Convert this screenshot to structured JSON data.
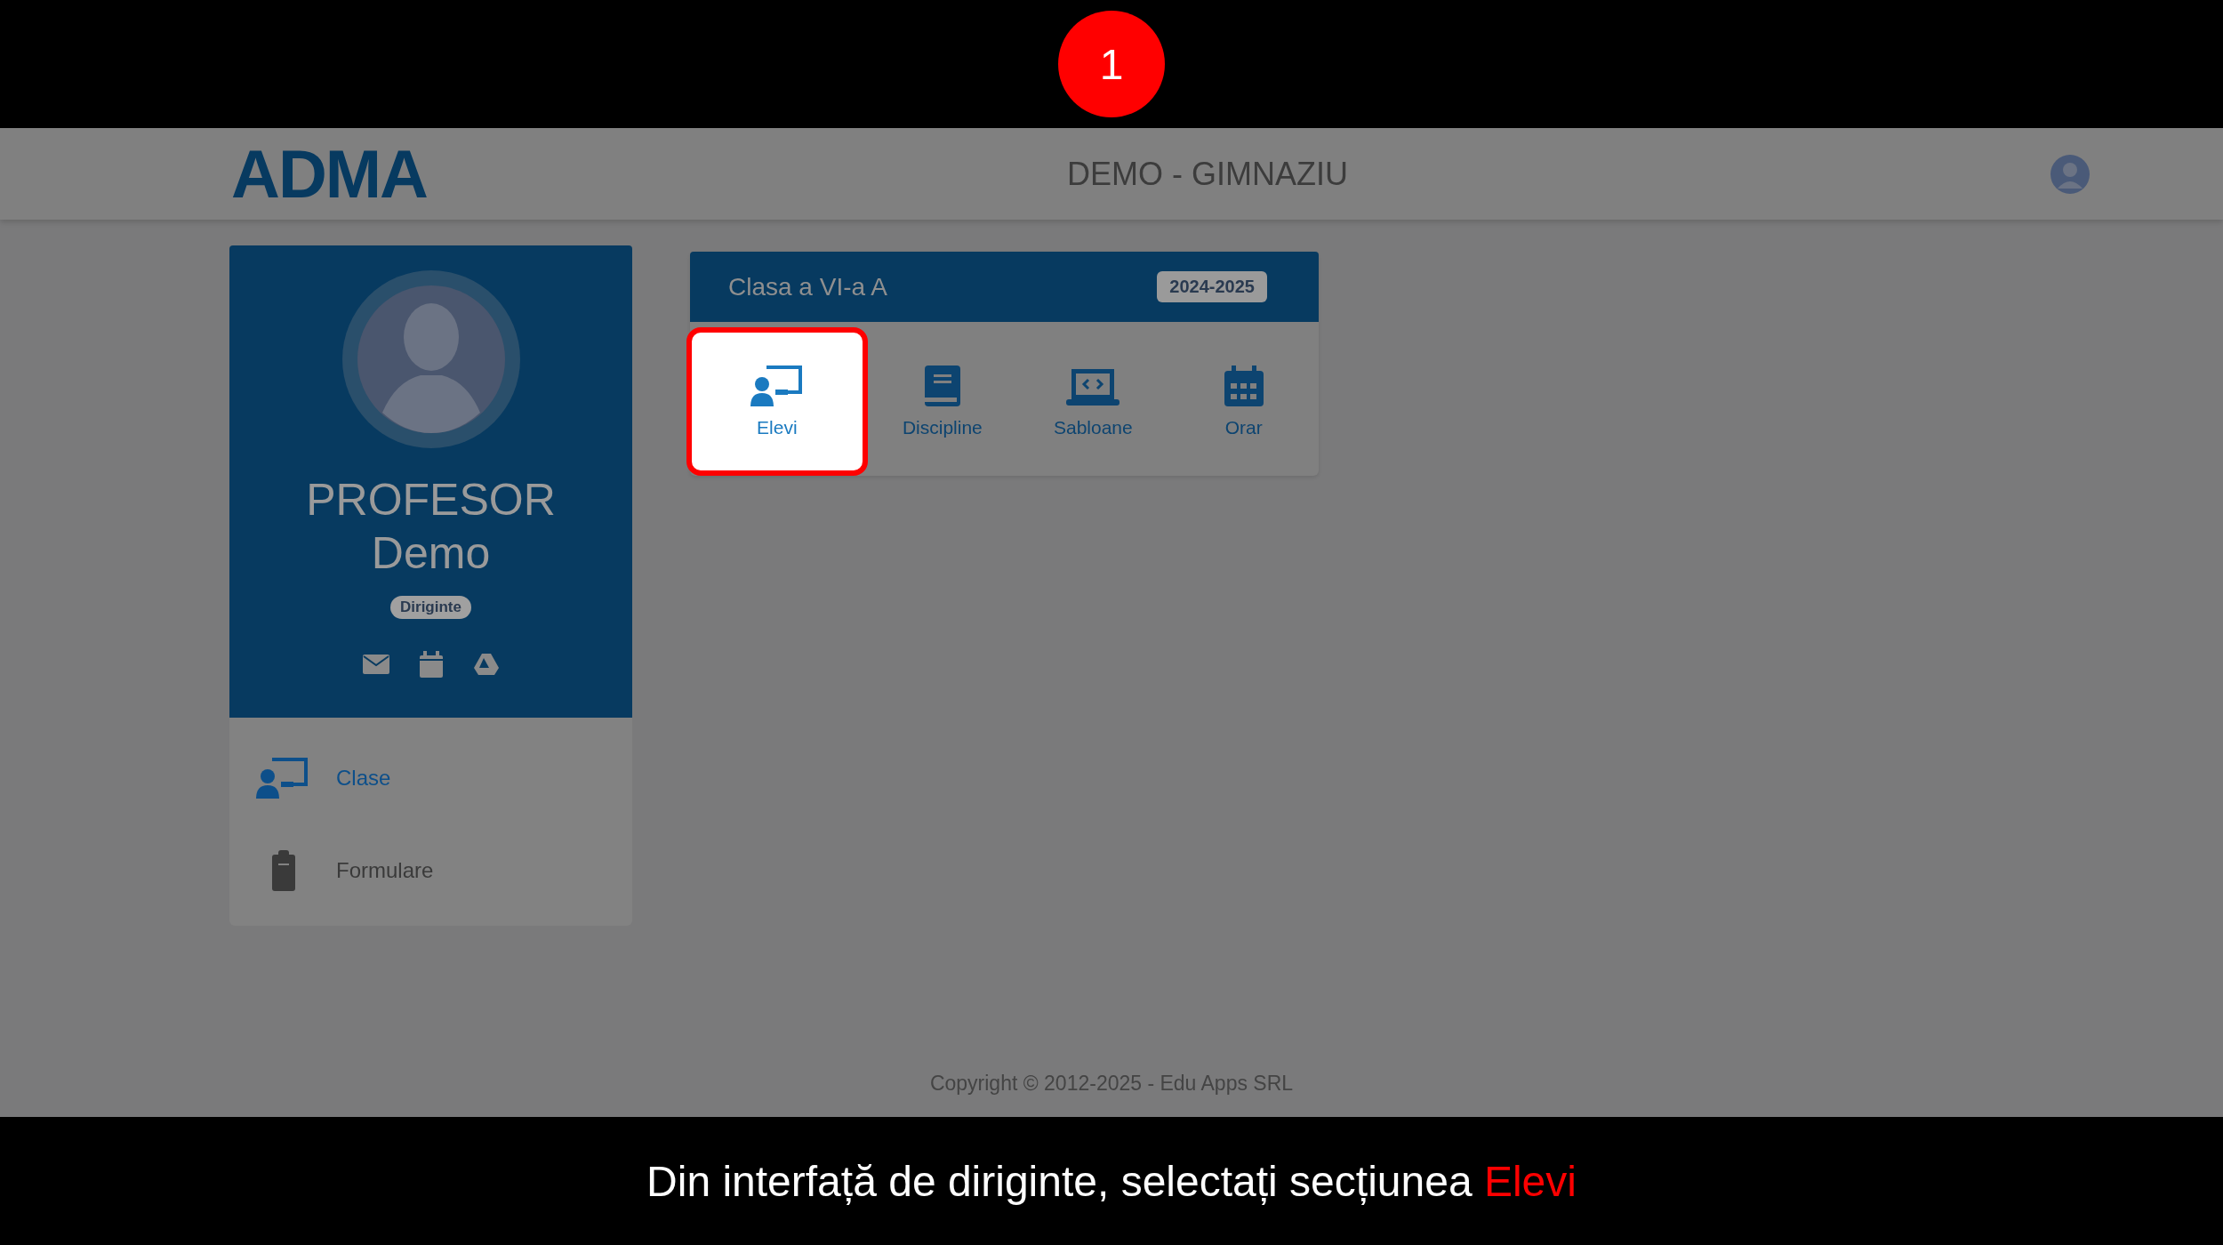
{
  "step_badge": "1",
  "header": {
    "logo": "ADMA",
    "title": "DEMO - GIMNAZIU"
  },
  "profile": {
    "name_line1": "PROFESOR",
    "name_line2": "Demo",
    "role_badge": "Diriginte"
  },
  "menu": [
    {
      "label": "Clase",
      "kind": "classes",
      "selected": true
    },
    {
      "label": "Formulare",
      "kind": "forms",
      "selected": false
    }
  ],
  "class_card": {
    "title": "Clasa a VI-a A",
    "year_badge": "2024-2025",
    "tiles": [
      {
        "label": "Elevi",
        "kind": "students",
        "selected": true
      },
      {
        "label": "Discipline",
        "kind": "book",
        "selected": false
      },
      {
        "label": "Sabloane",
        "kind": "laptop",
        "selected": false
      },
      {
        "label": "Orar",
        "kind": "calendar",
        "selected": false
      }
    ]
  },
  "footer": "Copyright © 2012-2025 - Edu Apps SRL",
  "caption": {
    "text": "Din interfață de diriginte, selectați secțiunea",
    "highlight": "Elevi"
  }
}
